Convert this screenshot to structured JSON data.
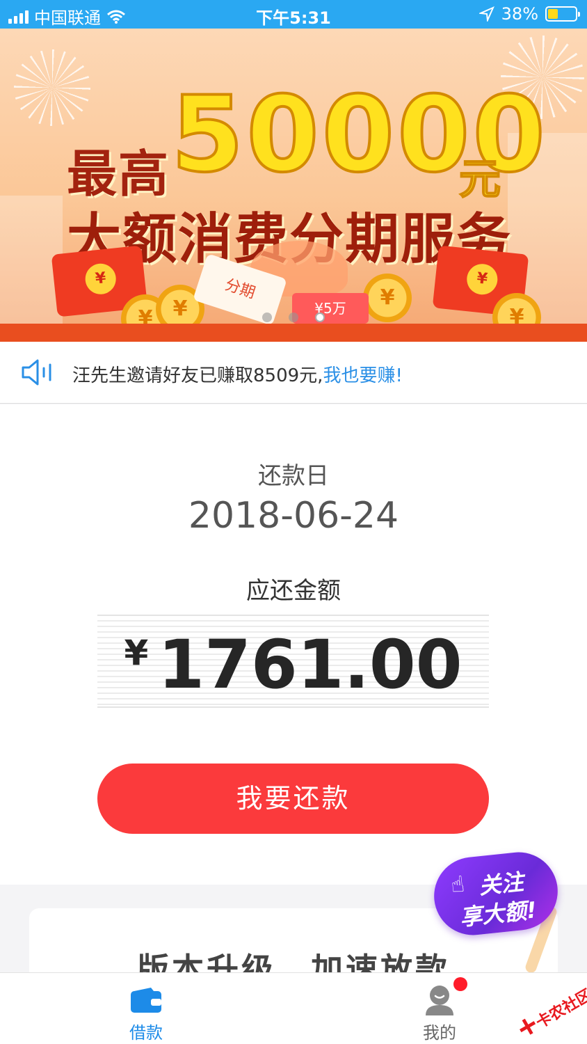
{
  "status_bar": {
    "carrier": "中国联通",
    "time": "下午5:31",
    "battery_percent": "38%",
    "battery_level": 0.38,
    "icons": [
      "signal-icon",
      "wifi-icon",
      "location-arrow-icon",
      "battery-icon"
    ]
  },
  "banner": {
    "line1_prefix": "最高",
    "amount": "50000",
    "unit": "元",
    "line2": "大额消费分期服务",
    "coupon_text": "分期",
    "ticket_text": "¥5万",
    "coin_symbol": "¥",
    "carousel": {
      "count": 3,
      "active_index": 2
    }
  },
  "notice": {
    "icon": "speaker-icon",
    "text": "汪先生邀请好友已赚取8509元,",
    "link": "我也要赚!"
  },
  "repayment": {
    "due_label": "还款日",
    "due_date": "2018-06-24",
    "amount_label": "应还金额",
    "currency": "¥",
    "amount": "1761.00",
    "button": "我要还款"
  },
  "upgrade_card": {
    "title": "版本升级、加速放款"
  },
  "follow_badge": {
    "line1": "关注",
    "line2": "享大额!"
  },
  "tab_bar": {
    "tabs": [
      {
        "label": "借款",
        "icon": "wallet-icon",
        "active": true
      },
      {
        "label": "我的",
        "icon": "person-icon",
        "active": false,
        "has_red_dot": true
      }
    ]
  },
  "watermark": {
    "text": "卡农社区"
  },
  "colors": {
    "status_bar": "#2aa8f2",
    "accent_blue": "#1d8be8",
    "link_blue": "#2a8fe6",
    "button_red": "#fb3a3c",
    "badge_purple": "#8e3bff"
  }
}
